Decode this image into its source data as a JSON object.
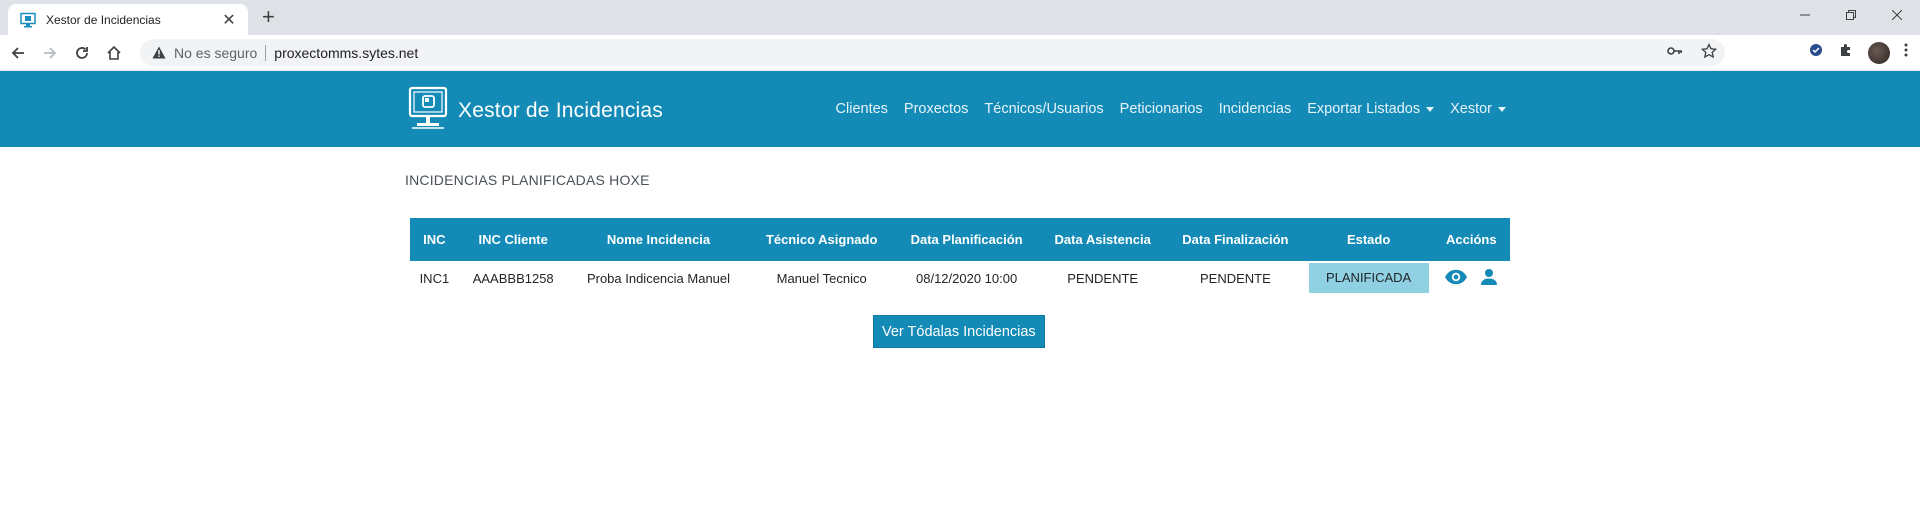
{
  "browser": {
    "tab_title": "Xestor de Incidencias",
    "tab_close": "✕",
    "new_tab": "+",
    "insecure_label": "No es seguro",
    "url": "proxectomms.sytes.net"
  },
  "app": {
    "brand": "Xestor de Incidencias",
    "nav": {
      "clientes": "Clientes",
      "proxectos": "Proxectos",
      "tecnicos": "Técnicos/Usuarios",
      "peticionarios": "Peticionarios",
      "incidencias": "Incidencias",
      "exportar": "Exportar Listados",
      "xestor": "Xestor"
    },
    "section_title": "INCIDENCIAS PLANIFICADAS HOXE",
    "table": {
      "headers": [
        "INC",
        "INC Cliente",
        "Nome Incidencia",
        "Técnico Asignado",
        "Data Planificación",
        "Data Asistencia",
        "Data Finalización",
        "Estado",
        "Accións"
      ],
      "rows": [
        [
          "INC1",
          "AAABBB1258",
          "Proba Indicencia Manuel",
          "Manuel Tecnico",
          "08/12/2020 10:00",
          "PENDENTE",
          "PENDENTE",
          "PLANIFICADA"
        ]
      ]
    },
    "view_all_button": "Ver Tódalas Incidencias"
  },
  "colors": {
    "primary": "#138bb6",
    "estado_bg": "#8fd0e3"
  },
  "icons": [
    "monitor-favicon-icon",
    "back-arrow-icon",
    "forward-arrow-icon",
    "reload-icon",
    "home-icon",
    "warning-icon",
    "key-icon",
    "star-icon",
    "extension-icon",
    "puzzle-icon",
    "avatar",
    "brand-monitor-icon",
    "eye-icon",
    "user-icon"
  ]
}
